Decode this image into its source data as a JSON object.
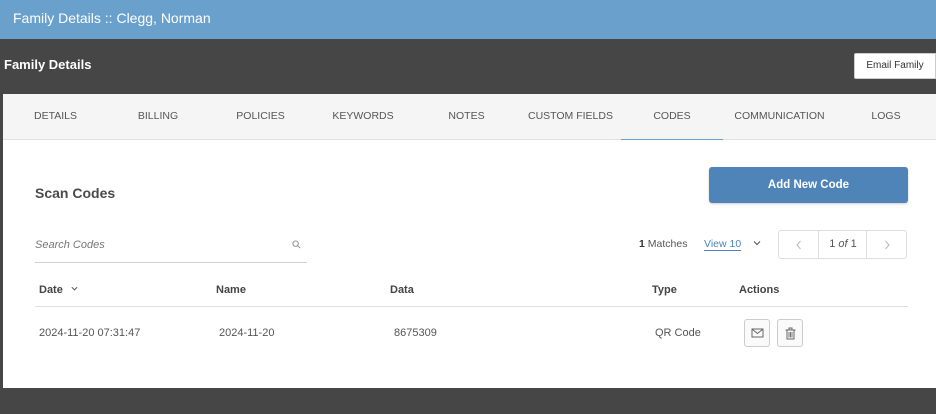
{
  "window": {
    "title": "Family Details :: Clegg, Norman"
  },
  "header": {
    "section_title": "Family Details",
    "email_button": "Email Family"
  },
  "tabs": [
    {
      "label": "DETAILS"
    },
    {
      "label": "BILLING"
    },
    {
      "label": "POLICIES"
    },
    {
      "label": "KEYWORDS"
    },
    {
      "label": "NOTES"
    },
    {
      "label": "CUSTOM FIELDS"
    },
    {
      "label": "CODES",
      "active": true
    },
    {
      "label": "COMMUNICATION"
    },
    {
      "label": "LOGS"
    }
  ],
  "codes": {
    "title": "Scan Codes",
    "add_button": "Add New Code",
    "search": {
      "placeholder": "Search Codes",
      "value": ""
    },
    "matches": {
      "count": "1",
      "label": " Matches"
    },
    "view": "View 10",
    "pager": {
      "current": "1",
      "of": "of",
      "total": "1"
    },
    "columns": {
      "date": "Date",
      "name": "Name",
      "data": "Data",
      "type": "Type",
      "actions": "Actions"
    },
    "rows": [
      {
        "date": "2024-11-20 07:31:47",
        "name": "2024-11-20",
        "data": "8675309",
        "type": "QR Code"
      }
    ]
  },
  "colors": {
    "titlebar": "#6aa0cc",
    "accent": "#4f84b8",
    "dark": "#464646"
  }
}
